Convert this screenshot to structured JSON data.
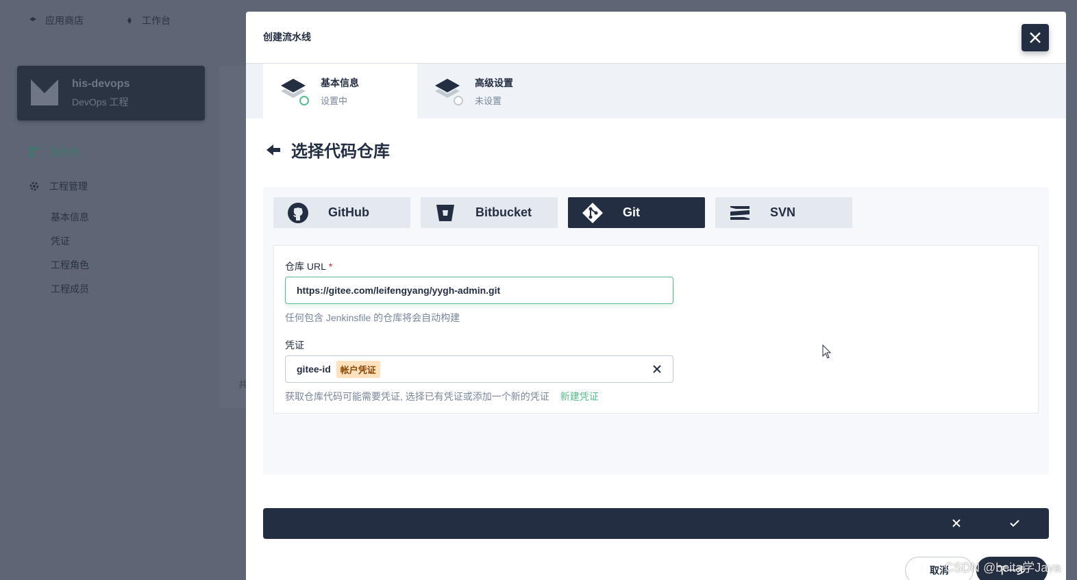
{
  "background": {
    "top_nav": [
      {
        "label": "应用商店",
        "icon": "app-store-icon"
      },
      {
        "label": "工作台",
        "icon": "workbench-icon"
      }
    ],
    "project": {
      "name": "his-devops",
      "type": "DevOps 工程"
    },
    "menu": [
      {
        "label": "流水线",
        "icon": "pipeline-icon",
        "active": true
      },
      {
        "label": "工程管理",
        "icon": "gear-icon",
        "active": false
      }
    ],
    "submenu": [
      "基本信息",
      "凭证",
      "工程角色",
      "工程成员"
    ],
    "panel_char": "共"
  },
  "modal": {
    "title": "创建流水线",
    "steps": [
      {
        "label": "基本信息",
        "status": "设置中",
        "active": true
      },
      {
        "label": "高级设置",
        "status": "未设置",
        "active": false
      }
    ],
    "heading": "选择代码仓库",
    "repo_types": [
      {
        "label": "GitHub",
        "icon": "github-icon",
        "selected": false
      },
      {
        "label": "Bitbucket",
        "icon": "bitbucket-icon",
        "selected": false
      },
      {
        "label": "Git",
        "icon": "git-icon",
        "selected": true
      },
      {
        "label": "SVN",
        "icon": "svn-icon",
        "selected": false
      }
    ],
    "form": {
      "url_label": "仓库 URL",
      "url_required": "*",
      "url_value": "https://gitee.com/leifengyang/yygh-admin.git",
      "url_help": "任何包含 Jenkinsfile 的仓库将会自动构建",
      "credential_label": "凭证",
      "credential_value": "gitee-id",
      "credential_badge": "帐户凭证",
      "credential_help": "获取仓库代码可能需要凭证, 选择已有凭证或添加一个新的凭证",
      "new_credential_link": "新建凭证"
    },
    "footer": {
      "cancel_label": "取消",
      "next_label": "下一步"
    }
  },
  "watermark": "CSDN @beita学Java",
  "colors": {
    "primary": "#242e42",
    "accent": "#55bc8a",
    "badge_bg": "#ffe1be",
    "required": "#ca2621"
  }
}
